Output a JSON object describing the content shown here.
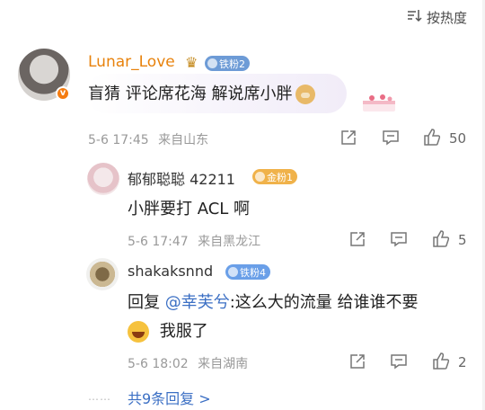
{
  "sort": {
    "label": "按热度",
    "icon": "sort-icon"
  },
  "main_comment": {
    "username": "Lunar_Love",
    "fan_badge": "铁粉2",
    "text": "盲猜 评论席花海 解说席小胖",
    "date": "5-6 17:45",
    "location": "来自山东",
    "likes": "50",
    "name_color": "#e8820c"
  },
  "replies": [
    {
      "username": "郁郁聪聪 42211",
      "fan_badge": "金粉1",
      "text": "小胖要打 ACL 啊",
      "date": "5-6 17:47",
      "location": "来自黑龙江",
      "likes": "5"
    },
    {
      "username": "shakaksnnd",
      "fan_badge": "铁粉4",
      "reply_prefix": "回复",
      "mention": "@幸芙兮",
      "text": ":这么大的流量 给谁谁不要",
      "text2": "我服了",
      "date": "5-6 18:02",
      "location": "来自湖南",
      "likes": "2"
    }
  ],
  "more_replies": {
    "dots": "……",
    "label": "共9条回复 >"
  },
  "colors": {
    "link": "#3b6fc4",
    "meta": "#999999",
    "username": "#e8820c"
  }
}
